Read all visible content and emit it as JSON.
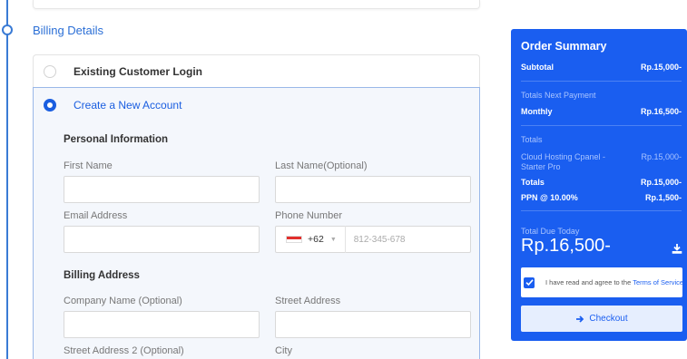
{
  "billing": {
    "section_title": "Billing Details",
    "existing_login_label": "Existing Customer Login",
    "create_account_label": "Create a New Account",
    "personal_info_title": "Personal Information",
    "first_name_label": "First Name",
    "last_name_label": "Last Name(Optional)",
    "email_label": "Email Address",
    "phone_label": "Phone Number",
    "phone_country_code": "+62",
    "phone_placeholder": "812-345-678",
    "billing_address_title": "Billing Address",
    "company_label": "Company Name (Optional)",
    "street_label": "Street Address",
    "street2_label": "Street Address 2 (Optional)",
    "city_label": "City"
  },
  "summary": {
    "title": "Order Summary",
    "subtotal_label": "Subtotal",
    "subtotal_value": "Rp.15,000-",
    "next_payment_heading": "Totals Next Payment",
    "monthly_label": "Monthly",
    "monthly_value": "Rp.16,500-",
    "totals_heading": "Totals",
    "item_name": "Cloud Hosting Cpanel - Starter Pro",
    "item_value": "Rp.15,000-",
    "totals_label": "Totals",
    "totals_value": "Rp.15,000-",
    "tax_label": "PPN @ 10.00%",
    "tax_value": "Rp.1,500-",
    "due_today_label": "Total Due Today",
    "due_today_value": "Rp.16,500-",
    "agree_text": "I have read and agree to the",
    "agree_link": "Terms of Service",
    "checkout_label": "Checkout"
  },
  "colors": {
    "accent": "#1a5ef0",
    "timeline": "#3a7bd5"
  },
  "icons": {
    "download": "download-icon",
    "checkout": "arrow-right-icon",
    "checkbox": "checkmark-icon"
  }
}
